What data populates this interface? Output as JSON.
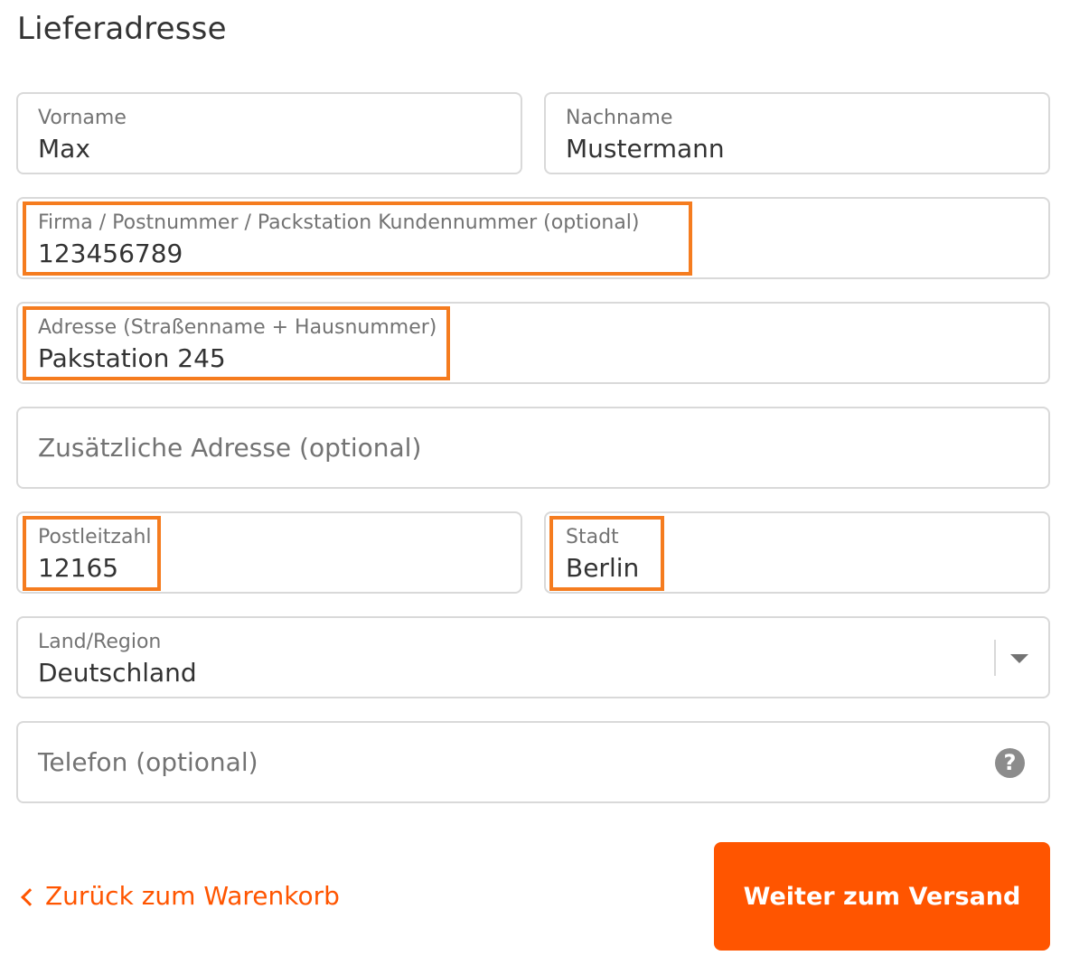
{
  "page": {
    "title": "Lieferadresse"
  },
  "form": {
    "first_name": {
      "label": "Vorname",
      "value": "Max"
    },
    "last_name": {
      "label": "Nachname",
      "value": "Mustermann"
    },
    "company": {
      "label": "Firma / Postnummer / Packstation Kundennummer (optional)",
      "value": "123456789"
    },
    "address": {
      "label": "Adresse (Straßenname + Hausnummer)",
      "value": "Pakstation 245"
    },
    "address2": {
      "placeholder": "Zusätzliche Adresse (optional)",
      "value": ""
    },
    "postal_code": {
      "label": "Postleitzahl",
      "value": "12165"
    },
    "city": {
      "label": "Stadt",
      "value": "Berlin"
    },
    "country": {
      "label": "Land/Region",
      "value": "Deutschland"
    },
    "phone": {
      "placeholder": "Telefon (optional)",
      "value": "",
      "help_icon": "?"
    }
  },
  "actions": {
    "back_label": "Zurück zum Warenkorb",
    "continue_label": "Weiter zum Versand"
  },
  "icons": {
    "back": "chevron-left-icon",
    "dropdown": "chevron-down-icon",
    "help": "question-circle-icon"
  },
  "colors": {
    "accent": "#ff5500",
    "highlight": "#f57c1f",
    "border": "#d9d9d9",
    "label": "#737373",
    "text": "#333333"
  }
}
